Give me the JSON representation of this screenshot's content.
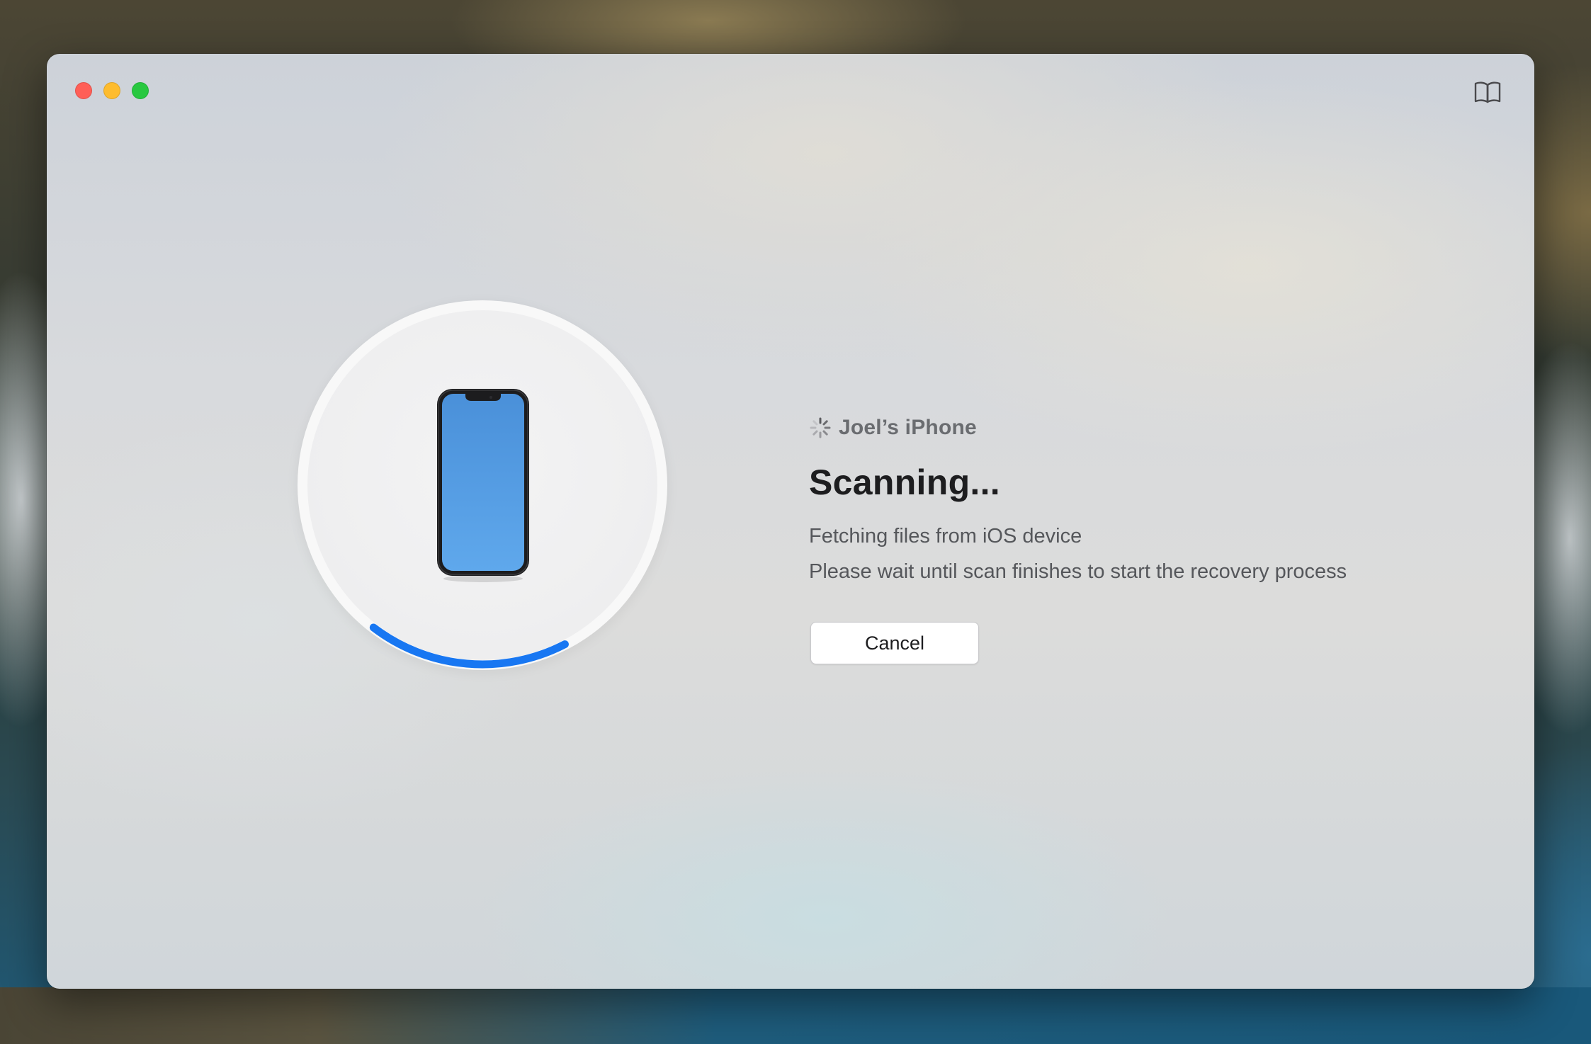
{
  "app": {
    "device_name": "Joel’s iPhone",
    "title": "Scanning...",
    "status_line_1": "Fetching files from iOS device",
    "status_line_2": "Please wait until scan finishes to start the recovery process",
    "cancel_label": "Cancel"
  },
  "window_controls": {
    "close": "close-button",
    "minimize": "minimize-button",
    "zoom": "zoom-button"
  },
  "toolbar": {
    "help_icon": "book-icon"
  },
  "progress": {
    "visible_arc_fraction": 0.18
  },
  "colors": {
    "progress_arc": "#1877f2",
    "phone_screen_top": "#4a90d9",
    "phone_screen_bottom": "#5fa8ec",
    "traffic_close": "#ff5f57",
    "traffic_minimize": "#febc2e",
    "traffic_zoom": "#28c840"
  },
  "icons": {
    "spinner": "activity-spinner-icon",
    "device": "iphone-icon"
  }
}
